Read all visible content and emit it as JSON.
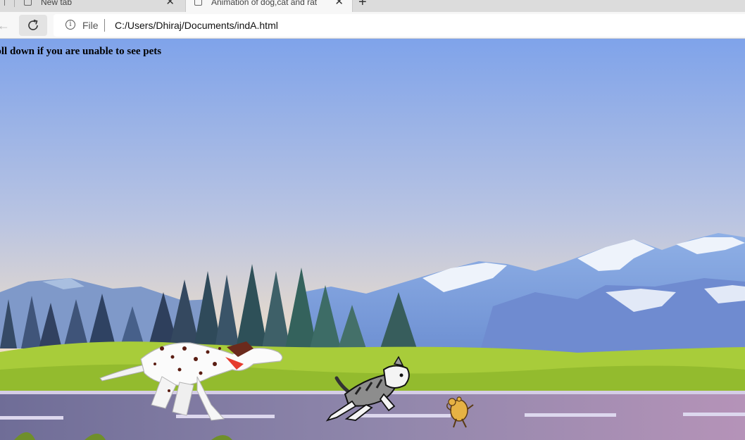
{
  "browser": {
    "tabs": [
      {
        "title": "New tab",
        "active": false
      },
      {
        "title": "Animation of dog,cat and rat",
        "active": true
      }
    ],
    "tab_close_glyph": "✕",
    "new_tab_glyph": "+",
    "address": {
      "security_label": "File",
      "url": "C:/Users/Dhiraj/Documents/indA.html"
    }
  },
  "page": {
    "notice": "roll down if you are unable to see pets",
    "scene": {
      "characters": [
        "dog",
        "cat",
        "rat"
      ],
      "colors": {
        "sky_top": "#7fa3ea",
        "sky_bottom": "#f3e0c6",
        "mountains": "#7d9ed8",
        "trees": "#354a66",
        "grass": "#a8cc3a",
        "road": "#8c84a8",
        "lane_marks": "#d9d4ec",
        "collar": "#e63c2e",
        "rat": "#e6b244"
      }
    }
  }
}
